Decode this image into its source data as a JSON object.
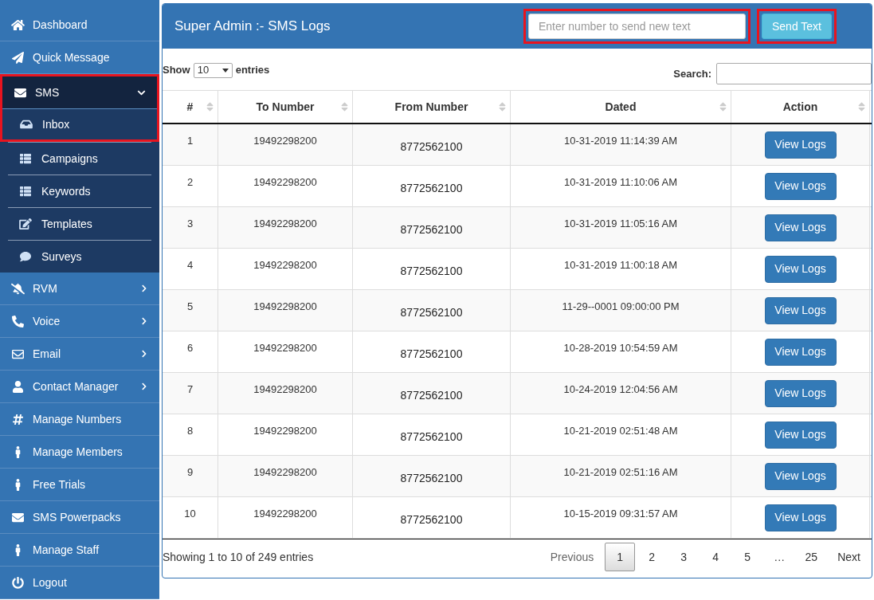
{
  "sidebar": {
    "items": [
      {
        "label": "Dashboard",
        "kind": "link",
        "selected": false
      },
      {
        "label": "Quick Message",
        "kind": "link",
        "selected": false
      },
      {
        "label": "SMS",
        "kind": "group",
        "selected": true,
        "expanded": true,
        "highlighted": true,
        "children": [
          {
            "label": "Inbox"
          },
          {
            "label": "Campaigns"
          },
          {
            "label": "Keywords"
          },
          {
            "label": "Templates"
          },
          {
            "label": "Surveys"
          }
        ]
      },
      {
        "label": "RVM",
        "kind": "group",
        "selected": false,
        "expanded": false
      },
      {
        "label": "Voice",
        "kind": "group",
        "selected": false,
        "expanded": false
      },
      {
        "label": "Email",
        "kind": "group",
        "selected": false,
        "expanded": false
      },
      {
        "label": "Contact Manager",
        "kind": "group",
        "selected": false,
        "expanded": false
      },
      {
        "label": "Manage Numbers",
        "kind": "link",
        "selected": false
      },
      {
        "label": "Manage Members",
        "kind": "link",
        "selected": false
      },
      {
        "label": "Free Trials",
        "kind": "link",
        "selected": false
      },
      {
        "label": "SMS Powerpacks",
        "kind": "link",
        "selected": false
      },
      {
        "label": "Manage Staff",
        "kind": "link",
        "selected": false
      },
      {
        "label": "Logout",
        "kind": "link",
        "selected": false
      }
    ]
  },
  "panel": {
    "title": "Super Admin :- SMS Logs",
    "number_field": {
      "placeholder": "Enter number to send new text",
      "highlighted": true
    },
    "send_button": {
      "label": "Send Text",
      "highlighted": true
    }
  },
  "length_control": {
    "before": "Show",
    "value": "10",
    "after": "entries"
  },
  "search": {
    "label": "Search:"
  },
  "table": {
    "columns": [
      "#",
      "To Number",
      "From Number",
      "Dated",
      "Action"
    ],
    "rows": [
      [
        "1",
        "19492298200",
        "8772562100",
        "10-31-2019 11:14:39 AM",
        "View Logs"
      ],
      [
        "2",
        "19492298200",
        "8772562100",
        "10-31-2019 11:10:06 AM",
        "View Logs"
      ],
      [
        "3",
        "19492298200",
        "8772562100",
        "10-31-2019 11:05:16 AM",
        "View Logs"
      ],
      [
        "4",
        "19492298200",
        "8772562100",
        "10-31-2019 11:00:18 AM",
        "View Logs"
      ],
      [
        "5",
        "19492298200",
        "8772562100",
        "11-29--0001 09:00:00 PM",
        "View Logs"
      ],
      [
        "6",
        "19492298200",
        "8772562100",
        "10-28-2019 10:54:59 AM",
        "View Logs"
      ],
      [
        "7",
        "19492298200",
        "8772562100",
        "10-24-2019 12:04:56 AM",
        "View Logs"
      ],
      [
        "8",
        "19492298200",
        "8772562100",
        "10-21-2019 02:51:48 AM",
        "View Logs"
      ],
      [
        "9",
        "19492298200",
        "8772562100",
        "10-21-2019 02:51:16 AM",
        "View Logs"
      ],
      [
        "10",
        "19492298200",
        "8772562100",
        "10-15-2019 09:31:57 AM",
        "View Logs"
      ]
    ]
  },
  "info": "Showing 1 to 10 of 249 entries",
  "pagination": {
    "previous": "Previous",
    "pages": [
      {
        "label": "1",
        "selected": true
      },
      {
        "label": "2",
        "selected": false
      },
      {
        "label": "3",
        "selected": false
      },
      {
        "label": "4",
        "selected": false
      },
      {
        "label": "5",
        "selected": false
      },
      {
        "label": "…",
        "selected": false
      },
      {
        "label": "25",
        "selected": false
      }
    ],
    "next": "Next"
  }
}
